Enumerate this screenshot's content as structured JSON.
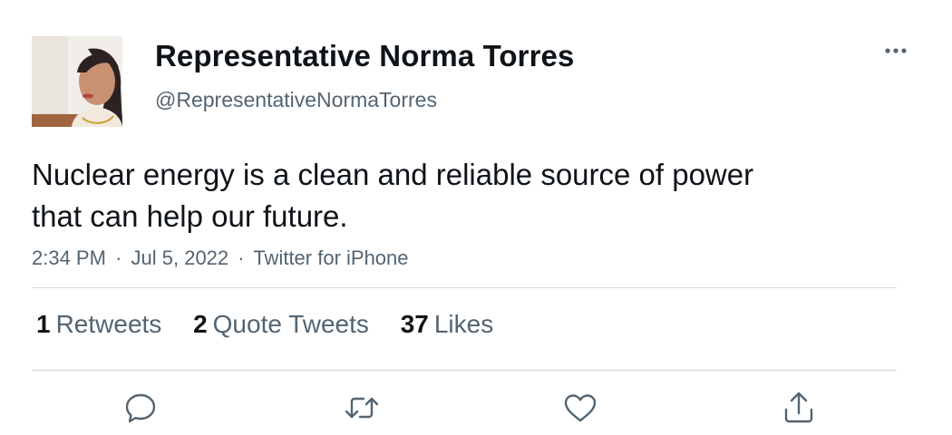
{
  "tweet": {
    "author": {
      "display_name": "Representative Norma Torres",
      "handle": "@RepresentativeNormaTorres",
      "avatar_icon": "profile-photo"
    },
    "text": "Nuclear energy is a clean and reliable source of power\nthat can help our future.",
    "meta": {
      "time": "2:34 PM",
      "separator": "·",
      "date": "Jul 5, 2022",
      "source": "Twitter for iPhone"
    },
    "stats": {
      "retweets_count": "1",
      "retweets_label": "Retweets",
      "quotes_count": "2",
      "quotes_label": "Quote Tweets",
      "likes_count": "37",
      "likes_label": "Likes"
    },
    "actions": [
      {
        "icon": "reply-icon"
      },
      {
        "icon": "retweet-icon"
      },
      {
        "icon": "like-icon"
      },
      {
        "icon": "share-icon"
      }
    ],
    "more_icon": "more-horizontal-icon"
  },
  "colors": {
    "text_primary": "#0f1419",
    "text_secondary": "#536471",
    "divider": "#cfd9de"
  }
}
